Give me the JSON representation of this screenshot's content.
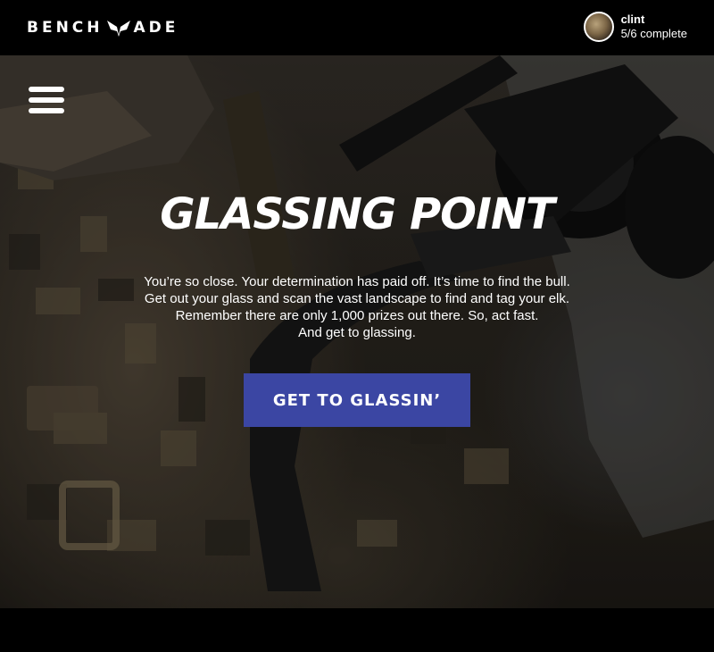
{
  "header": {
    "brand_left": "BENCH",
    "brand_right": "ADE",
    "logo_icon": "butterfly-logo-icon",
    "user": {
      "name": "clint",
      "progress": "5/6 complete",
      "avatar_icon": "user-avatar"
    }
  },
  "nav": {
    "menu_icon": "hamburger-menu-icon"
  },
  "hero": {
    "title": "GLASSING POINT",
    "body_lines": [
      "You’re so close. Your determination has paid off. It’s time to find the bull.",
      "Get out your glass and scan the vast landscape to find and tag your elk.",
      "Remember there are only 1,000 prizes out there. So, act fast.",
      "And get to glassing."
    ],
    "cta_label": "GET TO GLASSIN’",
    "background": "hunter-with-binoculars-photo"
  },
  "colors": {
    "background": "#000000",
    "cta": "#3b46a3",
    "text": "#ffffff"
  }
}
